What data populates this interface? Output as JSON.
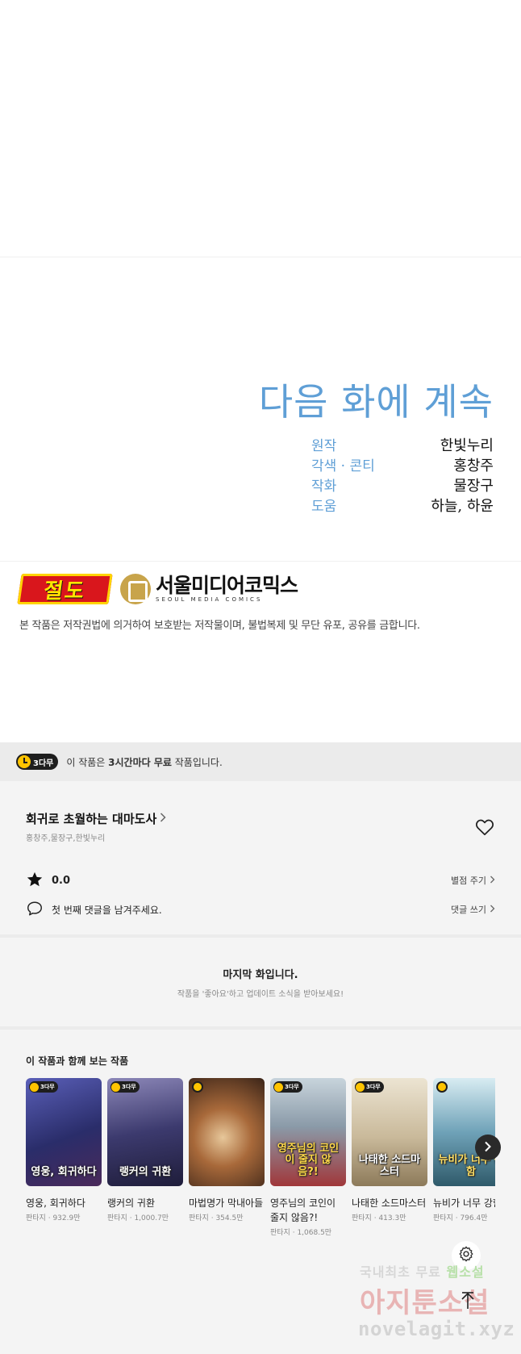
{
  "comic": {
    "to_be_continued": "다음 화에 계속",
    "credits": [
      {
        "role": "원작",
        "name": "한빛누리"
      },
      {
        "role": "각색 · 콘티",
        "name": "홍창주"
      },
      {
        "role": "작화",
        "name": "물장구"
      },
      {
        "role": "도움",
        "name": "하늘, 하윤"
      }
    ],
    "logo_jeolpo": "절도",
    "logo_seoul_ko": "서울미디어코믹스",
    "logo_seoul_en": "SEOUL MEDIA COMICS",
    "copyright": "본 작품은 저작권법에 의거하여 보호받는 저작물이며, 불법복제 및 무단 유포, 공유를 금합니다."
  },
  "notice": {
    "badge": "3다무",
    "text_prefix": "이 작품은 ",
    "text_bold": "3시간마다 무료",
    "text_suffix": " 작품입니다."
  },
  "work": {
    "title": "회귀로 초월하는 대마도사",
    "authors": "홍창주,물장구,한빛누리",
    "rating": "0.0",
    "rate_link": "별점 주기",
    "comment_prompt": "첫 번째 댓글을 남겨주세요.",
    "comment_link": "댓글 쓰기"
  },
  "last_episode": {
    "title": "마지막 화입니다.",
    "subtitle": "작품을 '좋아요'하고 업데이트 소식을 받아보세요!"
  },
  "recommendations": {
    "title": "이 작품과 함께 보는 작품",
    "items": [
      {
        "title": "영웅, 회귀하다",
        "genre": "판타지",
        "views": "932.9만",
        "badge": "3다무",
        "logo": "영웅, 회귀하다",
        "bg": "#3a3f8a"
      },
      {
        "title": "랭커의 귀환",
        "genre": "판타지",
        "views": "1,000.7만",
        "badge": "3다무",
        "logo": "랭커의 귀환",
        "bg": "#3c3a6e"
      },
      {
        "title": "마법명가 막내아들",
        "genre": "판타지",
        "views": "354.5만",
        "badge": "",
        "logo": "",
        "bg": "#7a4a2a"
      },
      {
        "title": "영주님의 코인이 줄지 않음?!",
        "genre": "판타지",
        "views": "1,068.5만",
        "badge": "3다무",
        "logo": "영주님의 코인이 줄지 않음?!",
        "bg": "#8a9aa8"
      },
      {
        "title": "나태한 소드마스터",
        "genre": "판타지",
        "views": "413.3만",
        "badge": "3다무",
        "logo": "나태한 소드마스터",
        "bg": "#c9b99a"
      },
      {
        "title": "뉴비가 너무 강함",
        "genre": "판타지",
        "views": "796.4만",
        "badge": "",
        "logo": "뉴비가 너무 강함",
        "bg": "#6fa2b8"
      }
    ]
  },
  "watermark": {
    "line1_a": "국내최초 무료 ",
    "line1_b": "웹소설",
    "line2": "아지툰소설",
    "line3": "novelagit.xyz"
  },
  "colors": {
    "accent_blue": "#5f9fd6",
    "badge_yellow": "#ffc400",
    "jeolpo_red": "#d9161c"
  },
  "icons": {
    "heart": "heart-icon",
    "star": "star-icon",
    "comment": "comment-icon",
    "chevron": "chevron-right-icon",
    "settings": "gear-icon",
    "top": "arrow-up-icon"
  }
}
